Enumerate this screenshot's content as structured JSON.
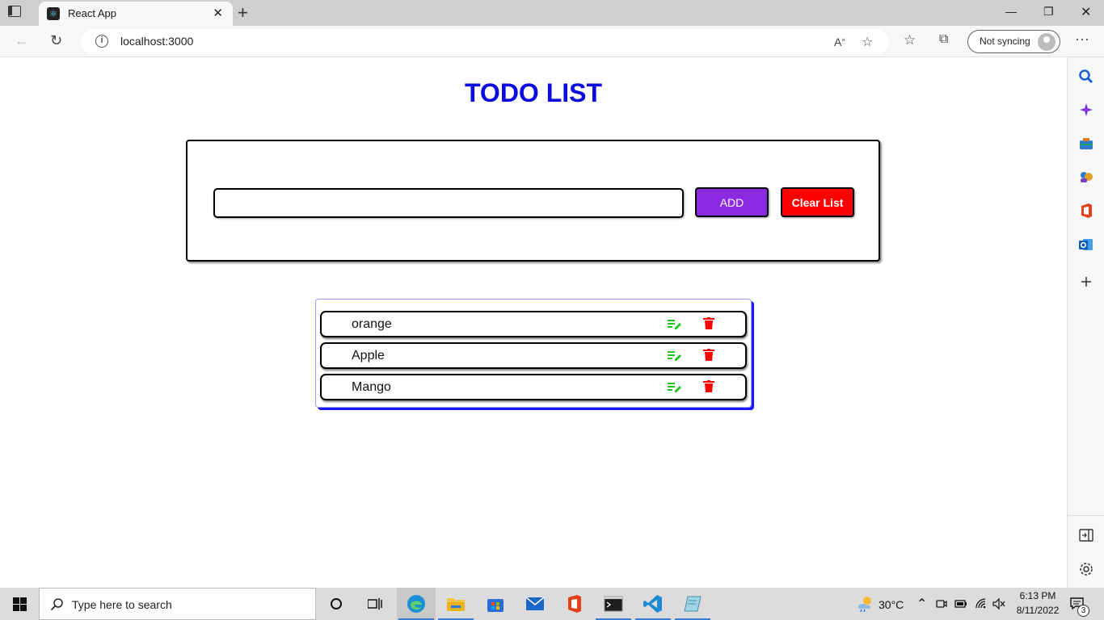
{
  "browser": {
    "tab_title": "React App",
    "url": "localhost:3000",
    "sync_label": "Not syncing"
  },
  "app": {
    "title": "TODO LIST",
    "input_placeholder": "",
    "add_label": "ADD",
    "clear_label": "Clear List",
    "items": [
      "orange",
      "Apple",
      "Mango"
    ]
  },
  "taskbar": {
    "search_placeholder": "Type here to search",
    "weather": "30°C",
    "time": "6:13 PM",
    "date": "8/11/2022",
    "notification_count": "3"
  },
  "colors": {
    "title": "#0a0adf",
    "add_button": "#8a2be2",
    "clear_button": "#ff0000",
    "edit_icon": "#22c222",
    "delete_icon": "#ff0000"
  }
}
